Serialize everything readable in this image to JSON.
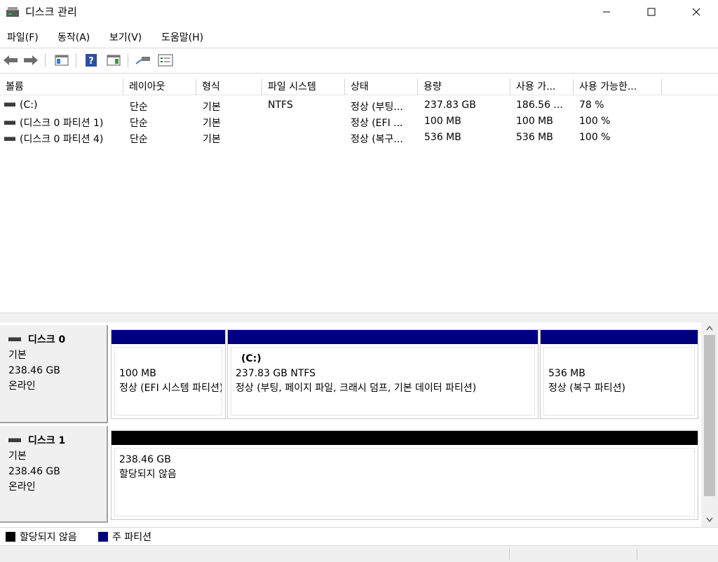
{
  "window": {
    "title": "디스크 관리",
    "minimize_glyph": "—",
    "maximize_glyph": "☐",
    "close_glyph": "✕"
  },
  "menu": {
    "items": [
      "파일(F)",
      "동작(A)",
      "보기(V)",
      "도움말(H)"
    ]
  },
  "toolbar": {
    "icons": [
      "back-arrow-icon",
      "forward-arrow-icon",
      "show-hide-console-tree-icon",
      "help-icon",
      "show-hide-action-pane-icon",
      "connect-icon",
      "properties-icon"
    ]
  },
  "volume_list": {
    "columns": [
      "볼륨",
      "레이아웃",
      "형식",
      "파일 시스템",
      "상태",
      "용량",
      "사용 가...",
      "사용 가능한..."
    ],
    "rows": [
      [
        "(C:)",
        "단순",
        "기본",
        "NTFS",
        "정상 (부팅...",
        "237.83 GB",
        "186.56 ...",
        "78 %"
      ],
      [
        "(디스크 0 파티션 1)",
        "단순",
        "기본",
        "",
        "정상 (EFI ...",
        "100 MB",
        "100 MB",
        "100 %"
      ],
      [
        "(디스크 0 파티션 4)",
        "단순",
        "기본",
        "",
        "정상 (복구...",
        "536 MB",
        "536 MB",
        "100 %"
      ]
    ]
  },
  "disks": [
    {
      "name": "디스크 0",
      "type": "기본",
      "size": "238.46 GB",
      "status": "온라인",
      "partitions": [
        {
          "name": "",
          "line1": "100 MB",
          "line2": "정상 (EFI 시스템 파티션)"
        },
        {
          "name": "(C:)",
          "line1": "237.83 GB NTFS",
          "line2": "정상 (부팅, 페이지 파일, 크래시 덤프, 기본 데이터 파티션)"
        },
        {
          "name": "",
          "line1": "536 MB",
          "line2": "정상 (복구 파티션)"
        }
      ]
    },
    {
      "name": "디스크 1",
      "type": "기본",
      "size": "238.46 GB",
      "status": "온라인",
      "partitions": [
        {
          "name": "",
          "line1": "238.46 GB",
          "line2": "할당되지 않음"
        }
      ]
    }
  ],
  "legend": [
    {
      "label": "할당되지 않음",
      "color": "#000000"
    },
    {
      "label": "주 파티션",
      "color": "#00007f"
    }
  ],
  "colors": {
    "primary_partition": "#00007f",
    "unallocated": "#000000"
  }
}
